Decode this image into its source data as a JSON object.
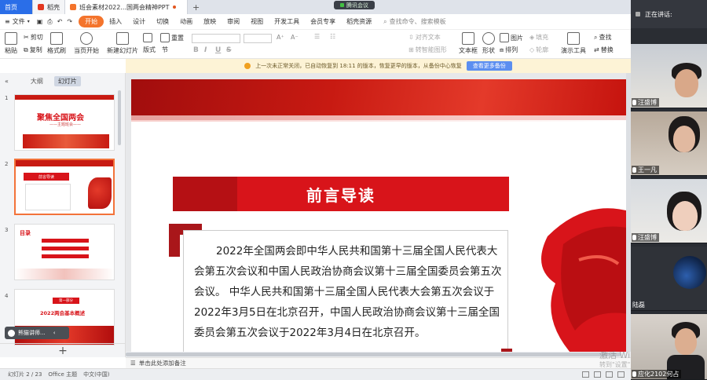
{
  "tabs": {
    "home": "首页",
    "doc": "稻壳",
    "active": "班会素材2022...国两会精神PPT",
    "add": "+"
  },
  "meeting_pill": "腾讯会议",
  "menu": {
    "lead": "文件",
    "items": [
      "开始",
      "插入",
      "设计",
      "切换",
      "动画",
      "放映",
      "审阅",
      "视图",
      "开发工具",
      "会员专享",
      "稻壳资源"
    ],
    "active": "开始",
    "search": "查找命令、搜索模板"
  },
  "toolbar": {
    "paste": "粘贴",
    "cut": "剪切",
    "copy": "复制",
    "format_painter": "格式刷",
    "from_current": "当页开始",
    "new_slide": "新建幻灯片",
    "layout": "版式",
    "section": "节",
    "reset": "重置",
    "textbox": "文本框",
    "shape": "形状",
    "arrange": "排列",
    "outline": "轮廓",
    "presenter": "演示工具",
    "replace": "替换",
    "picture": "图片",
    "fill": "填充",
    "find": "查找",
    "align_text": "对齐文本",
    "convert_smartart": "转智能图形",
    "bold": "B",
    "italic": "I",
    "underline": "U",
    "strike": "S"
  },
  "notice": {
    "text": "上一次未正常关闭，已自动恢复到 18:11 的版本，恢复更早的版本，从备份中心恢复",
    "button": "查看更多备份"
  },
  "left_panel": {
    "tab_outline": "大纲",
    "tab_slides": "幻灯片",
    "thumb1_title": "聚焦全国两会",
    "thumb1_sub": "——主题班会——",
    "thumb2_title": "前言导读",
    "thumb3_title": "目录",
    "thumb4_title": "2022两会基本概述",
    "thumb4_tag": "第一部分",
    "numbers": [
      "1",
      "2",
      "3",
      "4"
    ],
    "add": "+"
  },
  "chip": "熊猫讲师...",
  "slide": {
    "title": "前言导读",
    "body": "2022年全国两会即中华人民共和国第十三届全国人民代表大会第五次会议和中国人民政治协商会议第十三届全国委员会第五次会议。 中华人民共和国第十三届全国人民代表大会第五次会议于2022年3月5日在北京召开，中国人民政治协商会议第十三届全国委员会第五次会议于2022年3月4日在北京召开。"
  },
  "notes": "单击此处添加备注",
  "status": {
    "slide_count": "幻灯片 2 / 23",
    "theme": "Office 主题",
    "lang": "中文(中国)"
  },
  "watermark": {
    "line1": "激活 Windows",
    "line2": "转到\"设置\"以激活 Windows。"
  },
  "meeting": {
    "header": "正在讲话:",
    "participants": [
      {
        "name": "汪盛博"
      },
      {
        "name": "王一凡"
      },
      {
        "name": "汪盛博"
      },
      {
        "name": "陆磊"
      },
      {
        "name": "应化2102何占"
      }
    ]
  },
  "colors": {
    "accent_orange": "#f4742c",
    "slide_red": "#d8141a",
    "home_blue": "#2a6ee8"
  }
}
